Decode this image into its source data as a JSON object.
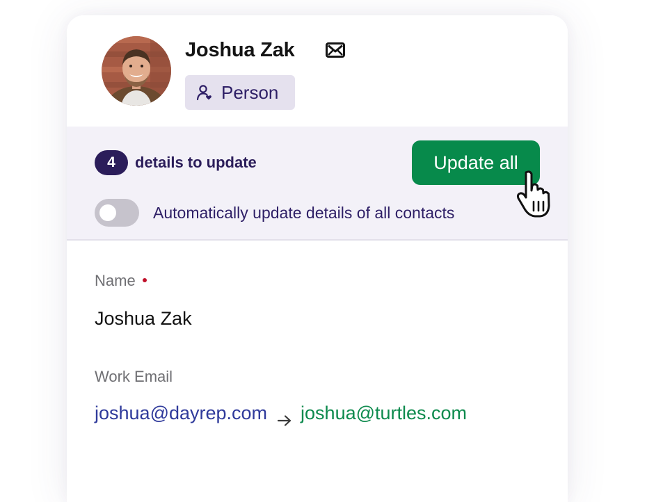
{
  "contact": {
    "name": "Joshua Zak",
    "type_label": "Person"
  },
  "update_panel": {
    "count": "4",
    "count_label": "details to update",
    "update_button_label": "Update all",
    "auto_update_label": "Automatically update details of all contacts",
    "auto_update_enabled": false
  },
  "fields": {
    "name": {
      "label": "Name",
      "required": true,
      "value": "Joshua Zak"
    },
    "work_email": {
      "label": "Work Email",
      "old_value": "joshua@dayrep.com",
      "new_value": "joshua@turtles.com"
    }
  },
  "icons": {
    "mail": "envelope-icon",
    "person": "person-icon",
    "arrow": "arrow-right-icon",
    "cursor": "hand-pointer-icon"
  },
  "colors": {
    "accent_purple": "#2b1d5a",
    "badge_bg": "#e5e1ee",
    "panel_bg": "#f3f1f8",
    "button_green": "#078a4b",
    "old_email_blue": "#2f3a9b",
    "new_email_green": "#0d8a4d",
    "required_red": "#c0102a"
  }
}
